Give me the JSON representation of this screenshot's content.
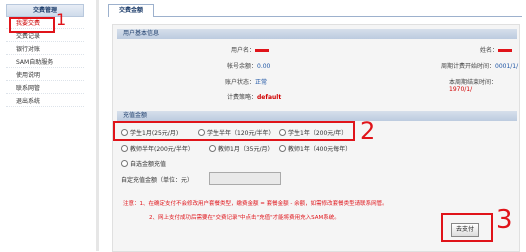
{
  "sidebar": {
    "title": "交费管理",
    "items": [
      {
        "label": "我要交费",
        "active": true
      },
      {
        "label": "交费记录"
      },
      {
        "label": "银行对账"
      },
      {
        "label": "SAM自助服务"
      },
      {
        "label": "使用说明"
      },
      {
        "label": "联系网管"
      },
      {
        "label": "退出系统"
      }
    ]
  },
  "main": {
    "tab_label": "交费金额",
    "basic_info": {
      "header": "用户基本信息",
      "username_label": "用户名：",
      "name_label": "姓名：",
      "balance_label": "帐号余额：",
      "balance_value": "0.00",
      "cycle_start_label": "周期计费开始时间：",
      "cycle_start_value": "0001/1/",
      "status_label": "账户状态：",
      "status_value": "正常",
      "cycle_end_label": "本周期结束时间：",
      "cycle_end_value": "1970/1/",
      "policy_label": "计费策略：",
      "policy_value": "default"
    },
    "recharge": {
      "header": "充值金额",
      "options": [
        "学生1月(25元/月)",
        "学生半年（120元/半年）",
        "学生1年（200元/年）",
        "教师半年(200元/半年）",
        "教师1月（35元/月）",
        "教师1年（400元每年）",
        "自选金额充值"
      ],
      "custom_label": "自定充值金额（单位：元）",
      "custom_value": ""
    },
    "notes": [
      "注意：1、在确定支付不会修改用户套餐类型，缴费金额 = 套餐金额 - 余额，如需修改套餐类型请联系网管。",
      "2、网上支付成功后需要在\"交费记录\"中点击\"充值\"才能将费用充入SAM系统。"
    ],
    "pay_button": "去支付"
  },
  "annotations": [
    "1",
    "2",
    "3"
  ],
  "colors": {
    "annotation_red": "#e0141a",
    "link_blue": "#1f56a5"
  }
}
